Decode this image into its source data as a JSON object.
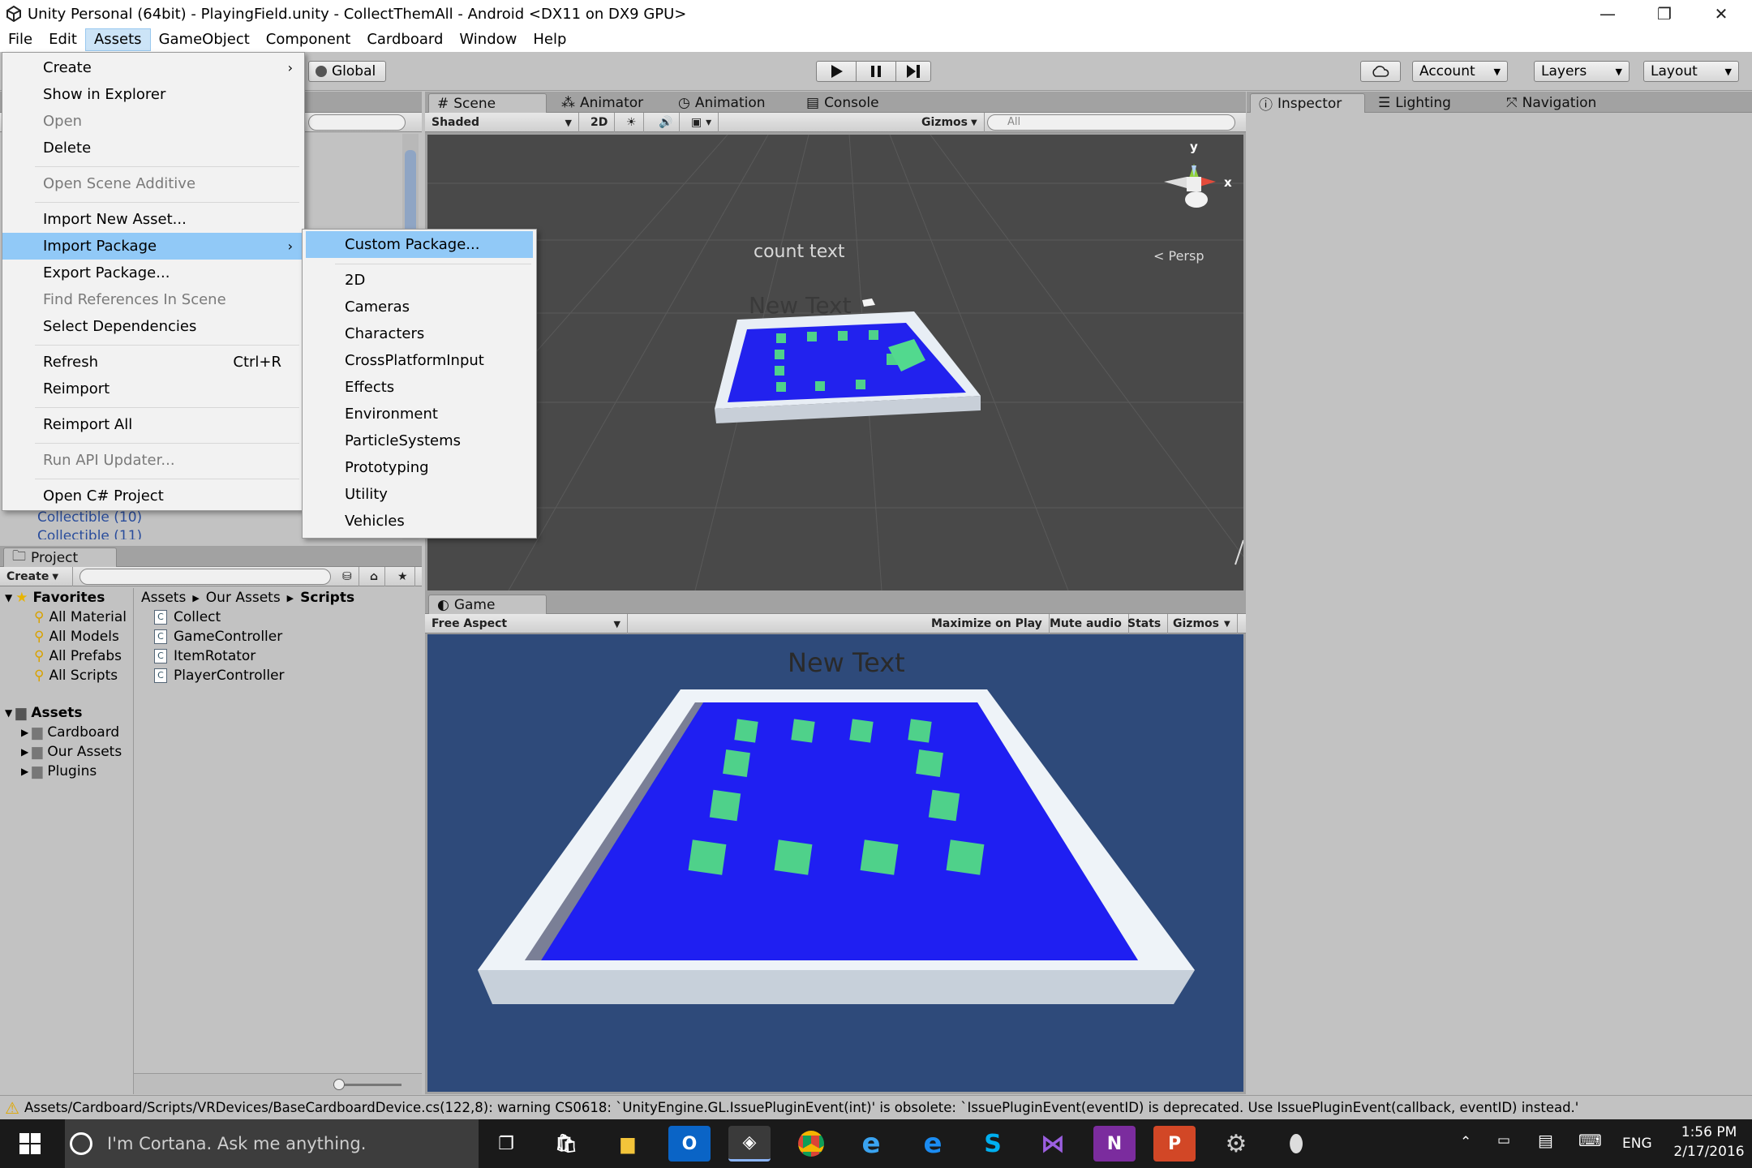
{
  "window": {
    "title": "Unity Personal (64bit) - PlayingField.unity - CollectThemAll - Android <DX11 on DX9 GPU>",
    "controls": [
      "—",
      "❐",
      "✕"
    ]
  },
  "menubar": [
    "File",
    "Edit",
    "Assets",
    "GameObject",
    "Component",
    "Cardboard",
    "Window",
    "Help"
  ],
  "toolbar": {
    "global_label": "Global",
    "account_label": "Account",
    "layers_label": "Layers",
    "layout_label": "Layout"
  },
  "assets_menu": [
    {
      "label": "Create",
      "submenu": true,
      "disabled": false
    },
    {
      "label": "Show in Explorer",
      "disabled": false
    },
    {
      "label": "Open",
      "disabled": true
    },
    {
      "label": "Delete",
      "disabled": false
    },
    {
      "label": "Open Scene Additive",
      "disabled": true
    },
    {
      "label": "Import New Asset...",
      "disabled": false
    },
    {
      "label": "Import Package",
      "submenu": true,
      "highlighted": true
    },
    {
      "label": "Export Package...",
      "disabled": false
    },
    {
      "label": "Find References In Scene",
      "disabled": true
    },
    {
      "label": "Select Dependencies",
      "disabled": false
    },
    {
      "label": "Refresh",
      "shortcut": "Ctrl+R",
      "disabled": false
    },
    {
      "label": "Reimport",
      "disabled": false
    },
    {
      "label": "Reimport All",
      "disabled": false
    },
    {
      "label": "Run API Updater...",
      "disabled": true
    },
    {
      "label": "Open C# Project",
      "disabled": false
    }
  ],
  "import_package_menu": [
    "Custom Package...",
    "2D",
    "Cameras",
    "Characters",
    "CrossPlatformInput",
    "Effects",
    "Environment",
    "ParticleSystems",
    "Prototyping",
    "Utility",
    "Vehicles"
  ],
  "hierarchy": {
    "items": [
      "Collectible (10)",
      "Collectible (11)"
    ]
  },
  "scene_tabs": [
    "Scene",
    "Animator",
    "Animation",
    "Console"
  ],
  "scene_toolbar": {
    "shading": "Shaded",
    "mode_2d": "2D",
    "gizmos": "Gizmos",
    "search_placeholder": "All"
  },
  "scene_view": {
    "count_text": "count text",
    "new_text": "New Text",
    "persp_label": "Persp",
    "axis_y": "y",
    "axis_x": "x"
  },
  "inspector_tabs": [
    "Inspector",
    "Lighting",
    "Navigation"
  ],
  "game": {
    "tab": "Game",
    "aspect": "Free Aspect",
    "maximize": "Maximize on Play",
    "mute": "Mute audio",
    "stats": "Stats",
    "gizmos": "Gizmos",
    "new_text": "New Text"
  },
  "project": {
    "tab": "Project",
    "create_label": "Create",
    "favorites_label": "Favorites",
    "favorites": [
      "All Material",
      "All Models",
      "All Prefabs",
      "All Scripts"
    ],
    "assets_label": "Assets",
    "asset_folders": [
      "Cardboard",
      "Our Assets",
      "Plugins"
    ],
    "breadcrumb": [
      "Assets",
      "Our Assets",
      "Scripts"
    ],
    "scripts": [
      "Collect",
      "GameController",
      "ItemRotator",
      "PlayerController"
    ]
  },
  "status": {
    "message": "Assets/Cardboard/Scripts/VRDevices/BaseCardboardDevice.cs(122,8): warning CS0618: `UnityEngine.GL.IssuePluginEvent(int)' is obsolete: `IssuePluginEvent(eventID) is deprecated. Use IssuePluginEvent(callback, eventID) instead.'"
  },
  "taskbar": {
    "cortana_placeholder": "I'm Cortana. Ask me anything.",
    "language": "ENG",
    "time": "1:56 PM",
    "date": "2/17/2016"
  }
}
